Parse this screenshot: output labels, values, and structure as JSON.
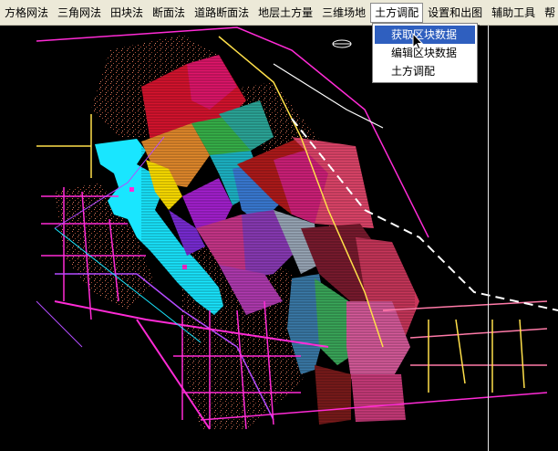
{
  "menu": {
    "items": [
      {
        "label": "方格网法"
      },
      {
        "label": "三角网法"
      },
      {
        "label": "田块法"
      },
      {
        "label": "断面法"
      },
      {
        "label": "道路断面法"
      },
      {
        "label": "地层土方量"
      },
      {
        "label": "三维场地"
      },
      {
        "label": "土方调配"
      },
      {
        "label": "设置和出图"
      },
      {
        "label": "辅助工具"
      },
      {
        "label": "帮"
      }
    ],
    "active_index": 7
  },
  "dropdown": {
    "items": [
      {
        "label": "获取区块数据"
      },
      {
        "label": "编辑区块数据"
      },
      {
        "label": "土方调配"
      }
    ],
    "highlighted_index": 0
  },
  "colors": {
    "canvas_bg": "#000000",
    "menubar_bg": "#ece9d8",
    "highlight": "#2f5fbf",
    "water": "#19e6ff",
    "road_magenta": "#ff2bd6",
    "road_yellow": "#ffe04a"
  }
}
